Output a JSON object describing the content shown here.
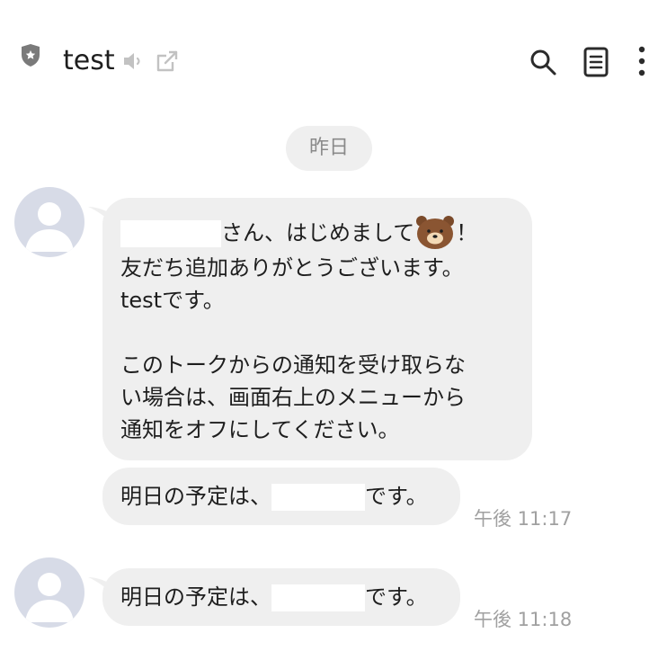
{
  "header": {
    "title": "test",
    "icons": [
      "shield-icon",
      "mute-icon",
      "external-link-icon",
      "search-icon",
      "memo-icon",
      "more-icon"
    ]
  },
  "date_divider": "昨日",
  "messages": [
    {
      "lines": {
        "l1_suffix": "さん、はじめまして",
        "l1_end": "！",
        "l2": "友だち追加ありがとうございます。",
        "l3": "testです。",
        "l5": "このトークからの通知を受け取らな",
        "l6": "い場合は、画面右上のメニューから",
        "l7": "通知をオフにしてください。"
      },
      "emoji": "bear-sticker-icon"
    },
    {
      "prefix": "明日の予定は、",
      "suffix": "です。",
      "time": "午後 11:17"
    },
    {
      "prefix": "明日の予定は、",
      "suffix": "です。",
      "time": "午後 11:18"
    }
  ],
  "colors": {
    "bubble": "#efefef",
    "avatar_bg": "#d7dbe7",
    "avatar_fg": "#ffffff",
    "time_text": "#a0a0a0",
    "icon": "#333333"
  }
}
